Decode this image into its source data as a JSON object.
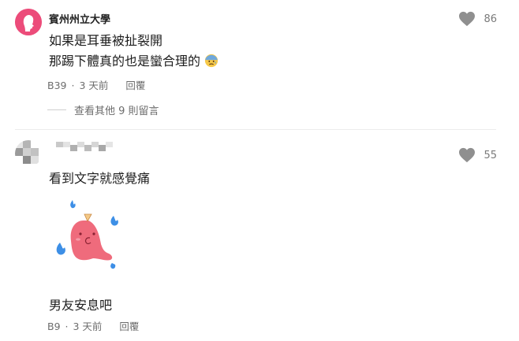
{
  "comments": [
    {
      "author": "賓州州立大學",
      "lines": [
        "如果是耳垂被扯裂開",
        "那踢下體真的也是蠻合理的"
      ],
      "emoji": "cold-sweat-face-icon",
      "floor": "B39",
      "time": "3 天前",
      "reply_label": "回覆",
      "likes": "86",
      "more_replies": "查看其他 9 則留言"
    },
    {
      "author": "",
      "lines": [
        "看到文字就感覺痛"
      ],
      "sticker": "pink-ghost-sticker-with-blue-flames",
      "text_after_sticker": "男友安息吧",
      "floor": "B9",
      "time": "3 天前",
      "reply_label": "回覆",
      "likes": "55"
    }
  ],
  "colors": {
    "avatar_pink": "#ec4c7a",
    "heart_gray": "#8f8f8f",
    "meta_gray": "#6d6d6d",
    "divider": "#ececec",
    "flame_blue": "#3d8fe6",
    "ghost_pink": "#ef6b7c"
  }
}
